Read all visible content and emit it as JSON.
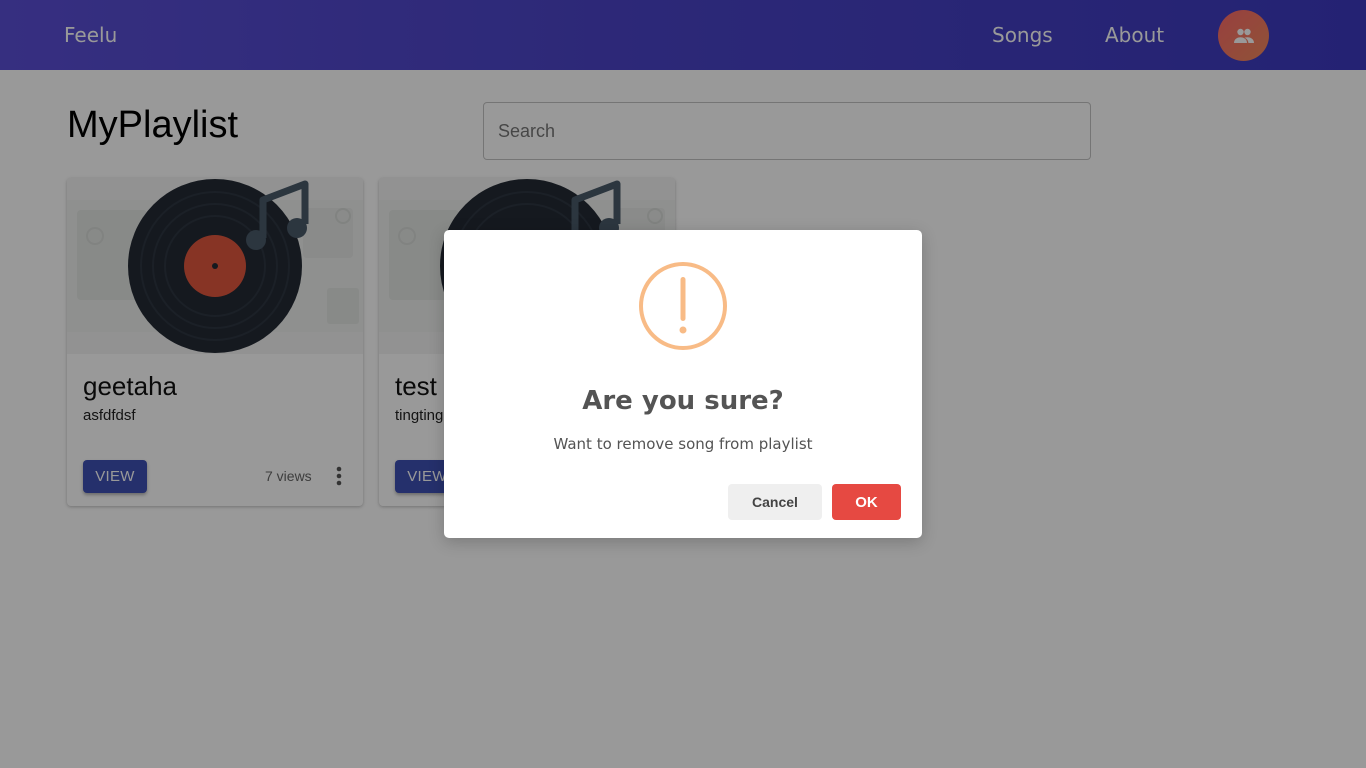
{
  "app": {
    "brand": "Feelu",
    "nav": {
      "songs": "Songs",
      "about": "About"
    },
    "avatar_icon": "people-icon"
  },
  "page": {
    "title": "MyPlaylist",
    "search": {
      "placeholder": "Search",
      "value": ""
    }
  },
  "cards": [
    {
      "title": "geetaha",
      "subtitle": "asfdfdsf",
      "button": "VIEW",
      "views": "7 views"
    },
    {
      "title": "test",
      "subtitle": "tingting",
      "button": "VIEW",
      "views": ""
    }
  ],
  "dialog": {
    "icon": "warning-icon",
    "title": "Are you sure?",
    "text": "Want to remove song from playlist",
    "cancel": "Cancel",
    "ok": "OK"
  },
  "colors": {
    "appbar_start": "#5b4fd6",
    "appbar_end": "#3d3ac0",
    "primary_button": "#3f51b5",
    "warning": "#f8bb86",
    "ok_button": "#e64942",
    "avatar": "#f0645a"
  }
}
